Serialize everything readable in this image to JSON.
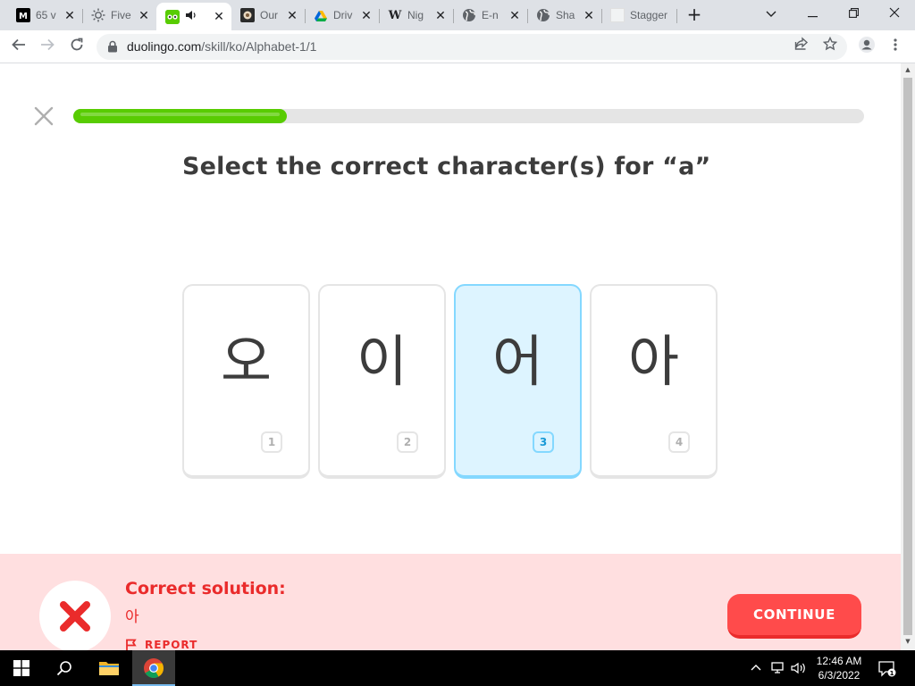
{
  "browser": {
    "tabs": [
      {
        "title": "65 v",
        "icon": "medium-icon"
      },
      {
        "title": "Five",
        "icon": "sun-icon"
      },
      {
        "title": "",
        "icon": "duolingo-icon",
        "audio": true,
        "active": true
      },
      {
        "title": "Our",
        "icon": "photo-icon"
      },
      {
        "title": "Driv",
        "icon": "drive-icon"
      },
      {
        "title": "Nig",
        "icon": "wikipedia-icon"
      },
      {
        "title": "E-n",
        "icon": "globe-icon"
      },
      {
        "title": "Sha",
        "icon": "globe-icon"
      },
      {
        "title": "Stagger",
        "icon": "blank-page-icon"
      }
    ],
    "url_host": "duolingo.com",
    "url_path": "/skill/ko/Alphabet-1/1"
  },
  "lesson": {
    "progress": 0.27,
    "prompt": "Select the correct character(s) for “a”",
    "choices": [
      {
        "char": "오",
        "key": "1",
        "selected": false
      },
      {
        "char": "이",
        "key": "2",
        "selected": false
      },
      {
        "char": "어",
        "key": "3",
        "selected": true
      },
      {
        "char": "아",
        "key": "4",
        "selected": false
      }
    ]
  },
  "feedback": {
    "title": "Correct solution:",
    "answer": "아",
    "report_label": "REPORT",
    "continue_label": "CONTINUE"
  },
  "taskbar": {
    "time": "12:46 AM",
    "date": "6/3/2022",
    "notification_count": "1"
  },
  "colors": {
    "duo_green": "#58cc02",
    "error_red": "#ea2b2b",
    "continue_red": "#ff4b4b",
    "feedback_bg": "#ffdfe0",
    "selected_bg": "#ddf4ff",
    "selected_border": "#84d8ff"
  }
}
